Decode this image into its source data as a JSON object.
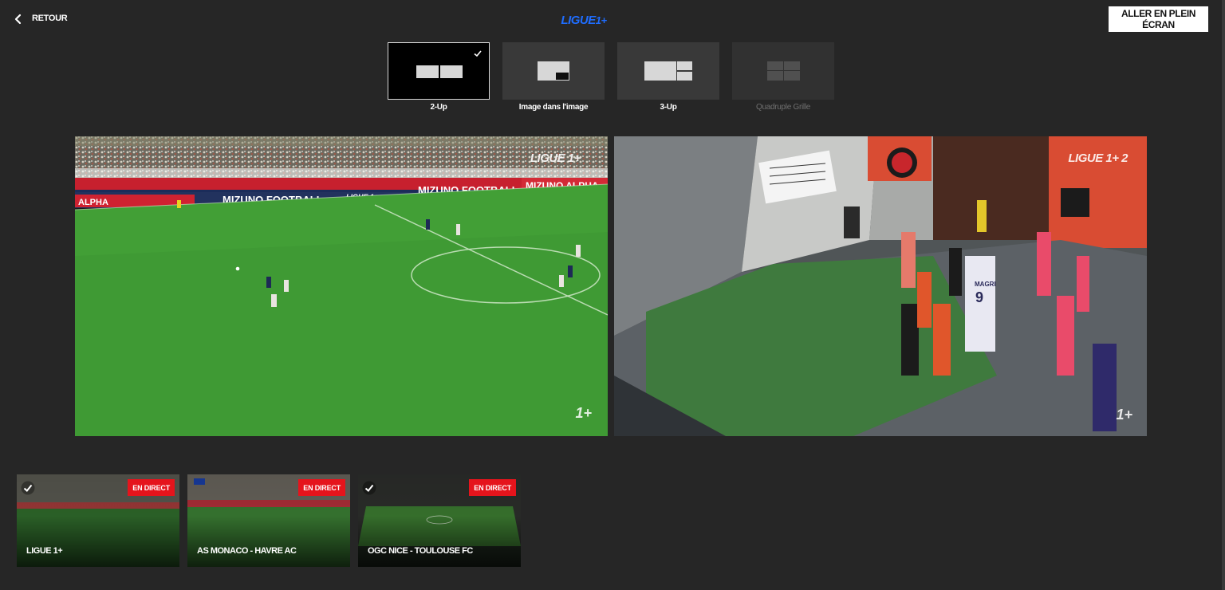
{
  "header": {
    "back_label": "RETOUR",
    "brand": "LIGUE",
    "brand_mark": "1+",
    "fullscreen_label": "ALLER EN PLEIN ÉCRAN"
  },
  "layouts": [
    {
      "label": "2-Up",
      "selected": true,
      "enabled": true
    },
    {
      "label": "Image dans l'image",
      "selected": false,
      "enabled": true
    },
    {
      "label": "3-Up",
      "selected": false,
      "enabled": true
    },
    {
      "label": "Quadruple Grille",
      "selected": false,
      "enabled": false
    }
  ],
  "players": [
    {
      "watermark_top": "LIGUE 1+",
      "watermark_corner": "1+",
      "ad_boards": [
        "MIZUNO FOOTBALL",
        "LIGUE 1+",
        "MIZUNO FOOTBALL",
        "MIZUNO ALPHA",
        "ALPHA"
      ]
    },
    {
      "watermark_top": "LIGUE 1+ 2",
      "watermark_corner": "1+",
      "jersey_name": "MAGRI",
      "jersey_number": "9"
    }
  ],
  "channels": [
    {
      "title": "LIGUE 1+",
      "badge": "EN DIRECT",
      "checked": true
    },
    {
      "title": "AS MONACO - HAVRE AC",
      "badge": "EN DIRECT",
      "checked": false
    },
    {
      "title": "OGC NICE - TOULOUSE FC",
      "badge": "EN DIRECT",
      "checked": true
    }
  ],
  "colors": {
    "background": "#262626",
    "accent_blue": "#1f6dff",
    "live_red": "#e5141c",
    "pitch_green": "#3f9a34"
  }
}
